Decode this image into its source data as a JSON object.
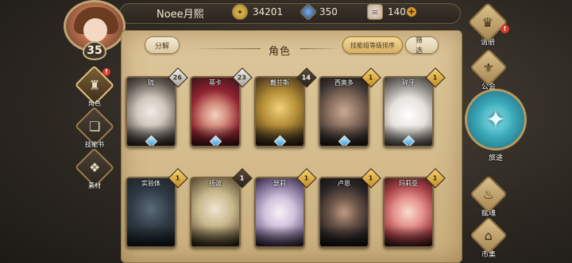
{
  "player": {
    "name": "Noee月熙",
    "level": "35"
  },
  "resources": {
    "gold": {
      "icon": "gold-coin-icon",
      "value": "34201"
    },
    "gem": {
      "icon": "blue-crystal-icon",
      "value": "350"
    },
    "stamina": {
      "icon": "stamina-scroll-icon",
      "value": "140",
      "plus": "+"
    }
  },
  "left_tabs": [
    {
      "label": "角色",
      "icon": "helmet-icon",
      "badge": "!"
    },
    {
      "label": "技能书",
      "icon": "skill-book-icon"
    },
    {
      "label": "素材",
      "icon": "material-icon"
    }
  ],
  "panel": {
    "title": "角色",
    "decompose": "分解",
    "sort": "技能组等级排序",
    "filter": "筛选"
  },
  "heroes": [
    {
      "name": "琉",
      "level": "26"
    },
    {
      "name": "蒂卡",
      "level": "23"
    },
    {
      "name": "戴芬斯",
      "level": "14"
    },
    {
      "name": "西奥多",
      "level": "1"
    },
    {
      "name": "碎牙",
      "level": "1"
    },
    {
      "name": "实验体",
      "level": "1"
    },
    {
      "name": "扬波",
      "level": "1"
    },
    {
      "name": "瑟莉",
      "level": "1"
    },
    {
      "name": "卢恩",
      "level": "1"
    },
    {
      "name": "玛莉亚",
      "level": "1"
    }
  ],
  "right_menu": {
    "register": {
      "label": "请册",
      "badge": "!"
    },
    "guild": {
      "label": "公会"
    },
    "journey": {
      "label": "旅途"
    },
    "talent": {
      "label": "赋魂"
    },
    "market": {
      "label": "市集"
    }
  },
  "colors": {
    "accent_gold": "#d6b066",
    "parchment": "#d8c193",
    "badge_red": "#d63b2b",
    "gem_blue": "#3f8fd0"
  }
}
